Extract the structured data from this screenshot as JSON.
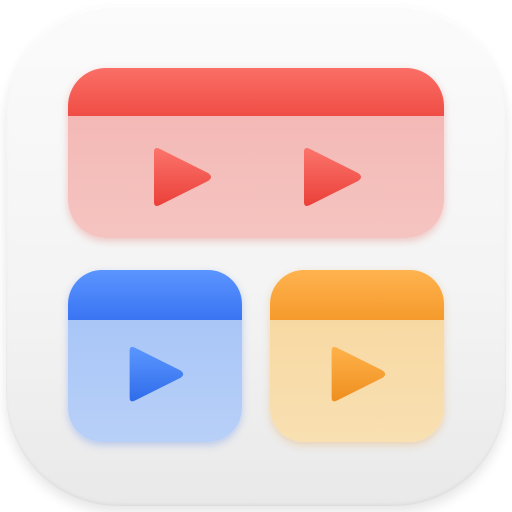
{
  "icon": {
    "name": "video-grid-app-icon",
    "colors": {
      "base": "#f5f5f5",
      "red_bar": "#f4574f",
      "red_body": "#f5bfbc",
      "red_play": "#ef4f47",
      "blue_bar": "#4582f7",
      "blue_body": "#b0cbf7",
      "blue_play": "#3d7cf3",
      "orange_bar": "#f7a53a",
      "orange_body": "#f8dcab",
      "orange_play": "#f39a2a"
    },
    "panels": [
      {
        "name": "red-video-panel",
        "play_icons": 2
      },
      {
        "name": "blue-video-panel",
        "play_icons": 1
      },
      {
        "name": "orange-video-panel",
        "play_icons": 1
      }
    ]
  }
}
